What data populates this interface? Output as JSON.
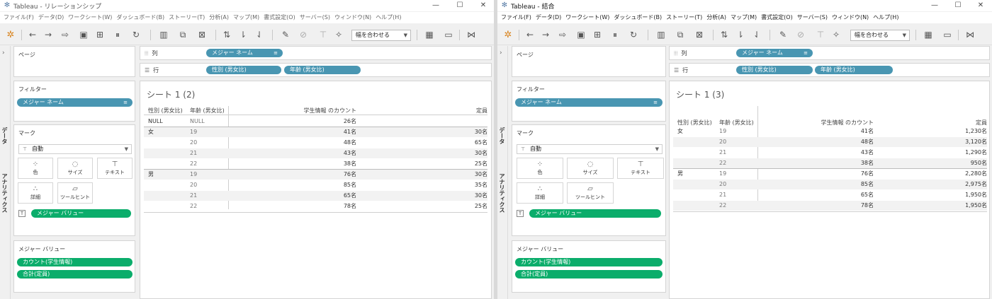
{
  "left_window": {
    "title": "Tableau - リレーションシップ",
    "menu": [
      "ファイル(F)",
      "データ(D)",
      "ワークシート(W)",
      "ダッシュボード(B)",
      "ストーリー(T)",
      "分析(A)",
      "マップ(M)",
      "書式設定(O)",
      "サーバー(S)",
      "ウィンドウ(N)",
      "ヘルプ(H)"
    ],
    "fit_select": "幅を合わせる",
    "side_tabs": {
      "data": "データ",
      "analytics": "アナリティクス"
    },
    "pages_title": "ページ",
    "filters": {
      "title": "フィルター",
      "pills": [
        "メジャー ネーム"
      ]
    },
    "marks": {
      "title": "マーク",
      "type": "自動",
      "buttons": {
        "color": "色",
        "size": "サイズ",
        "text": "テキスト",
        "detail": "詳細",
        "tooltip": "ツールヒント"
      },
      "measure_pill": "メジャー バリュー"
    },
    "measure_values": {
      "title": "メジャー バリュー",
      "pills": [
        "カウント(学生情報)",
        "合計(定員)"
      ]
    },
    "columns_shelf": {
      "label": "列",
      "pill": "メジャー ネーム"
    },
    "rows_shelf": {
      "label": "行",
      "pills": [
        "性別 (男女比)",
        "年齢 (男女比)"
      ]
    },
    "sheet_title": "シート 1 (2)",
    "table": {
      "headers": [
        "性別 (男女比)",
        "年齢 (男女比)",
        "学生情報 のカウント",
        "定員"
      ],
      "groups": [
        {
          "gender": "NULL",
          "rows": [
            {
              "age": "NULL",
              "count": "26名",
              "capacity": ""
            }
          ]
        },
        {
          "gender": "女",
          "rows": [
            {
              "age": "19",
              "count": "41名",
              "capacity": "30名"
            },
            {
              "age": "20",
              "count": "48名",
              "capacity": "65名"
            },
            {
              "age": "21",
              "count": "43名",
              "capacity": "30名"
            },
            {
              "age": "22",
              "count": "38名",
              "capacity": "25名"
            }
          ]
        },
        {
          "gender": "男",
          "rows": [
            {
              "age": "19",
              "count": "76名",
              "capacity": "30名"
            },
            {
              "age": "20",
              "count": "85名",
              "capacity": "35名"
            },
            {
              "age": "21",
              "count": "65名",
              "capacity": "30名"
            },
            {
              "age": "22",
              "count": "78名",
              "capacity": "25名"
            }
          ]
        }
      ]
    }
  },
  "right_window": {
    "title": "Tableau - 結合",
    "menu": [
      "ファイル(F)",
      "データ(D)",
      "ワークシート(W)",
      "ダッシュボード(B)",
      "ストーリー(T)",
      "分析(A)",
      "マップ(M)",
      "書式設定(O)",
      "サーバー(S)",
      "ウィンドウ(N)",
      "ヘルプ(H)"
    ],
    "fit_select": "幅を合わせる",
    "side_tabs": {
      "data": "データ",
      "analytics": "アナリティクス"
    },
    "pages_title": "ページ",
    "filters": {
      "title": "フィルター",
      "pills": [
        "メジャー ネーム"
      ]
    },
    "marks": {
      "title": "マーク",
      "type": "自動",
      "buttons": {
        "color": "色",
        "size": "サイズ",
        "text": "テキスト",
        "detail": "詳細",
        "tooltip": "ツールヒント"
      },
      "measure_pill": "メジャー バリュー"
    },
    "measure_values": {
      "title": "メジャー バリュー",
      "pills": [
        "カウント(学生情報)",
        "合計(定員)"
      ]
    },
    "columns_shelf": {
      "label": "列",
      "pill": "メジャー ネーム"
    },
    "rows_shelf": {
      "label": "行",
      "pills": [
        "性別 (男女比)",
        "年齢 (男女比)"
      ]
    },
    "sheet_title": "シート 1 (3)",
    "table": {
      "headers": [
        "性別 (男女比)",
        "年齢 (男女比)",
        "学生情報 のカウント",
        "定員"
      ],
      "groups": [
        {
          "gender": "女",
          "rows": [
            {
              "age": "19",
              "count": "41名",
              "capacity": "1,230名"
            },
            {
              "age": "20",
              "count": "48名",
              "capacity": "3,120名"
            },
            {
              "age": "21",
              "count": "43名",
              "capacity": "1,290名"
            },
            {
              "age": "22",
              "count": "38名",
              "capacity": "950名"
            }
          ]
        },
        {
          "gender": "男",
          "rows": [
            {
              "age": "19",
              "count": "76名",
              "capacity": "2,280名"
            },
            {
              "age": "20",
              "count": "85名",
              "capacity": "2,975名"
            },
            {
              "age": "21",
              "count": "65名",
              "capacity": "1,950名"
            },
            {
              "age": "22",
              "count": "78名",
              "capacity": "1,950名"
            }
          ]
        }
      ]
    }
  },
  "colors": {
    "dimension_pill": "#4996b2",
    "measure_pill": "#0bad6b",
    "tableau_logo": "#d9841f"
  },
  "icons": {
    "toolbar": [
      "tableau-logo-icon",
      "undo-icon",
      "redo-icon",
      "replay-icon",
      "save-icon",
      "new-datasource-icon",
      "pause-icon",
      "refresh-icon",
      "new-sheet-icon",
      "duplicate-icon",
      "clear-icon",
      "swap-icon",
      "sort-asc-icon",
      "sort-desc-icon",
      "highlight-icon",
      "group-icon",
      "label-icon",
      "pin-icon",
      "show-me-icon",
      "presentation-icon",
      "share-icon"
    ]
  }
}
